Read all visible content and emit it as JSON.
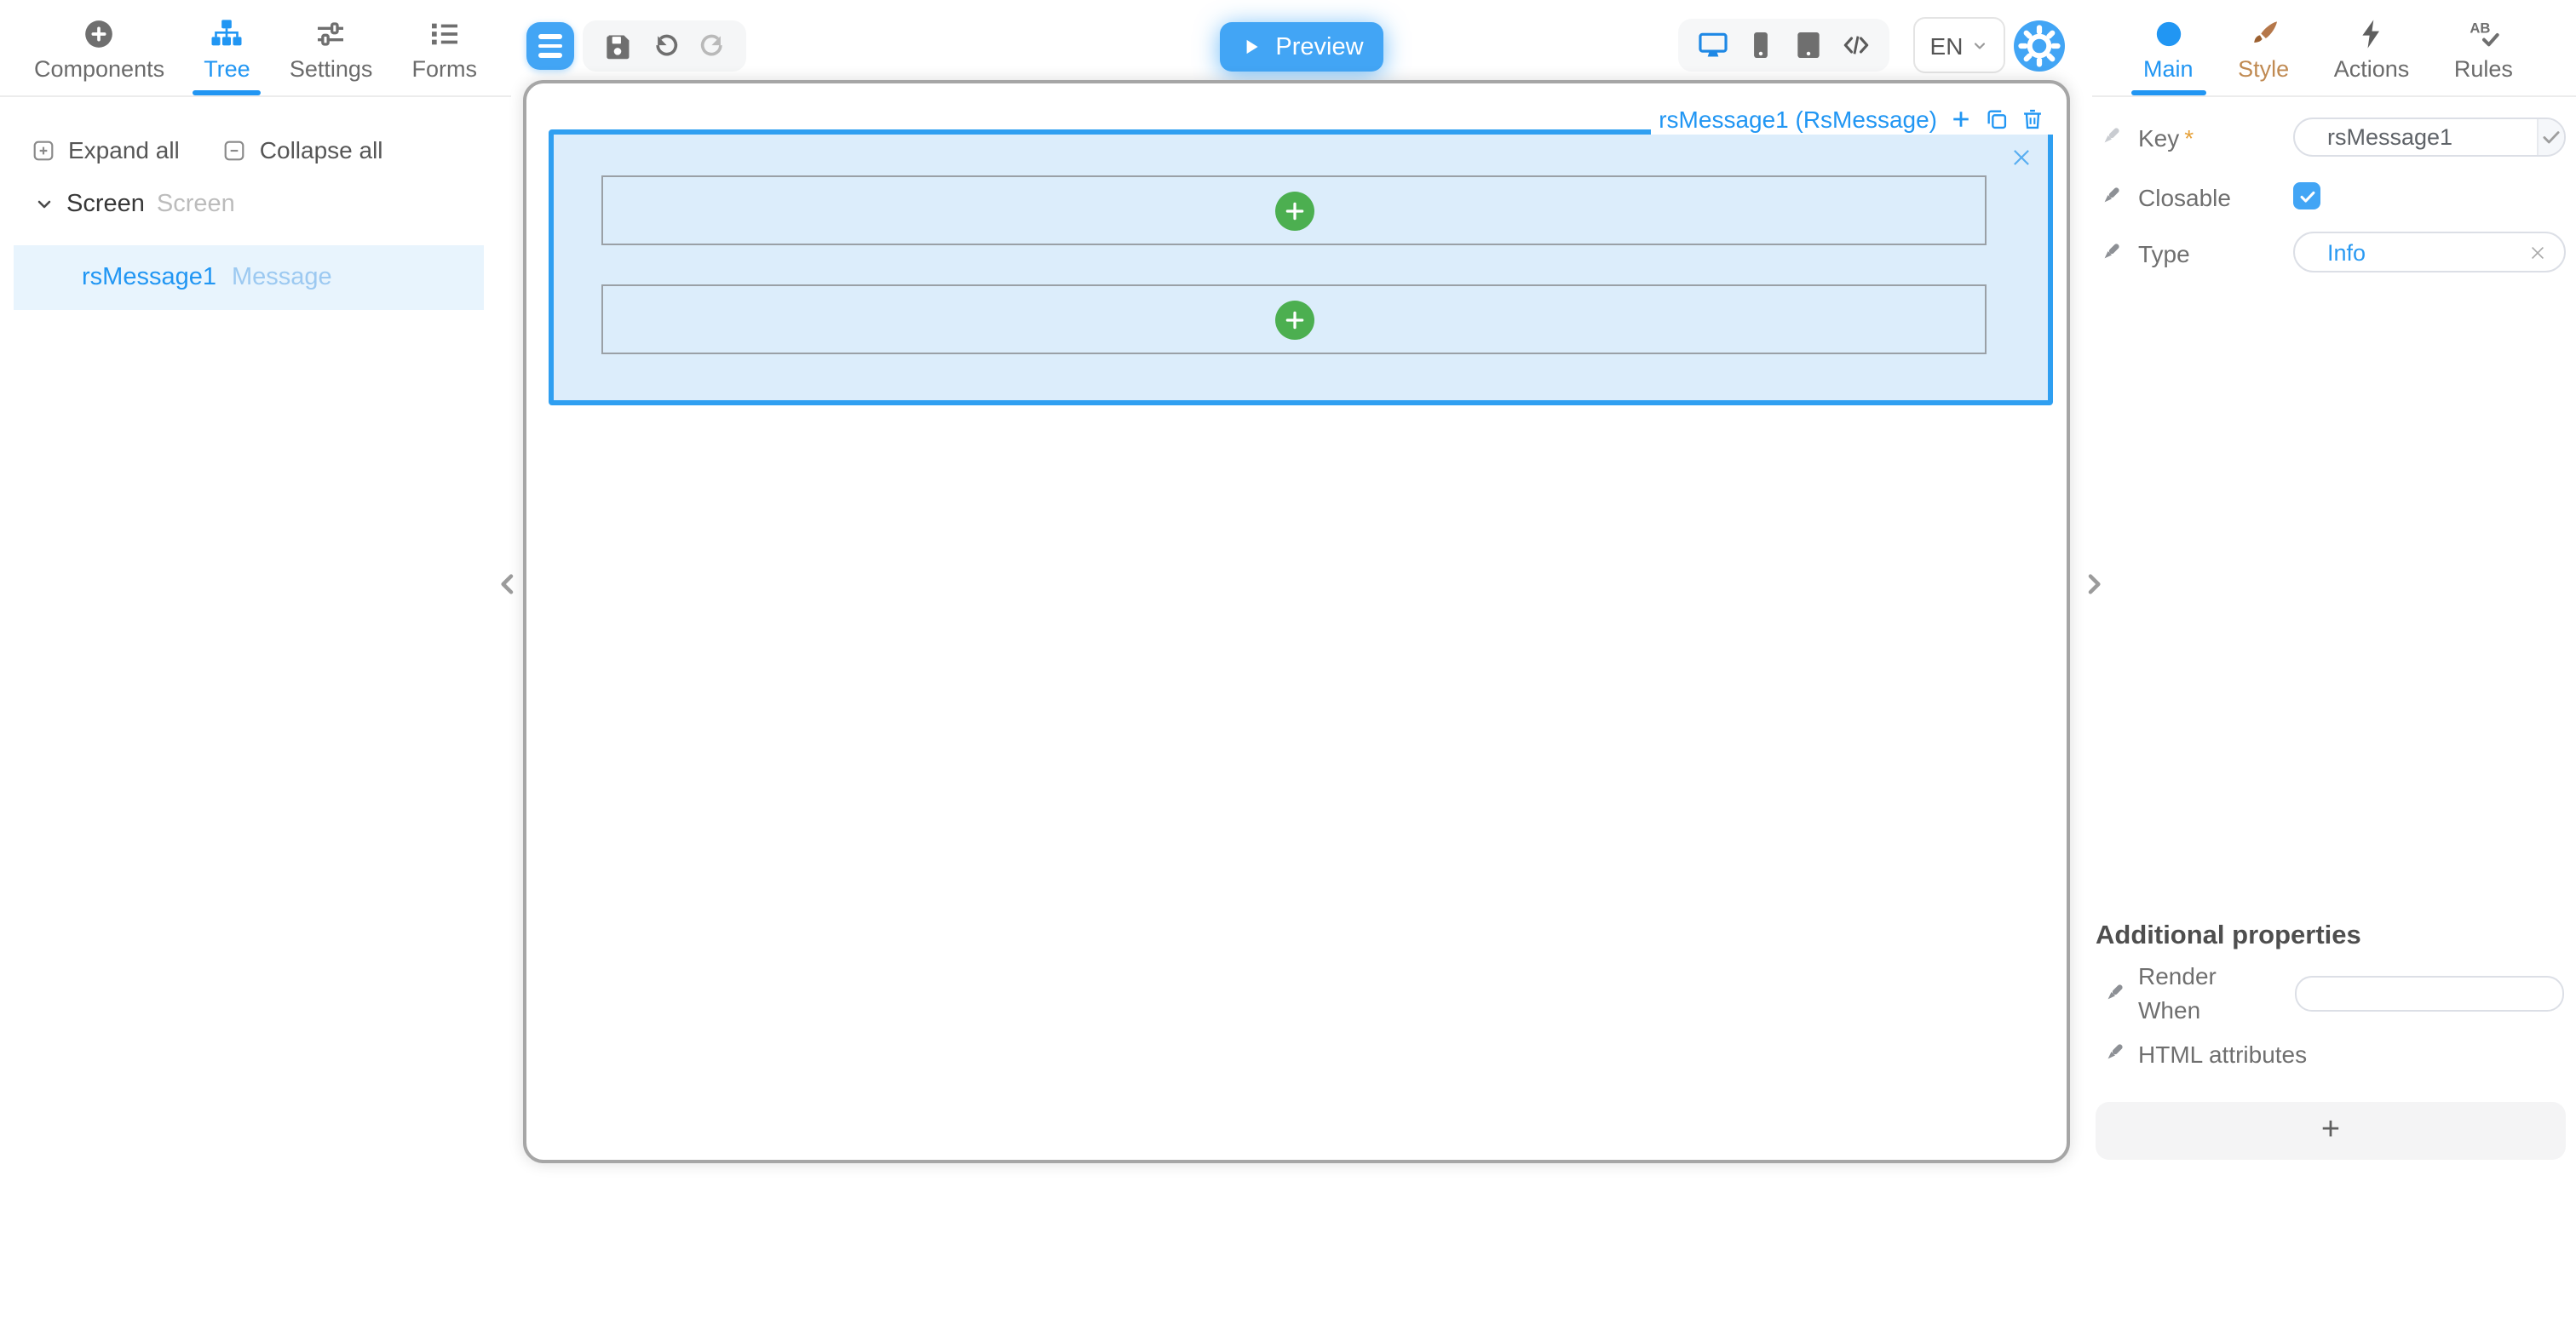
{
  "left_tabs": {
    "components": "Components",
    "tree": "Tree",
    "settings": "Settings",
    "forms": "Forms"
  },
  "tree_panel": {
    "expand_all": "Expand all",
    "collapse_all": "Collapse all",
    "root_name": "Screen",
    "root_type": "Screen",
    "node_name": "rsMessage1",
    "node_type": "Message"
  },
  "toolbar": {
    "preview": "Preview",
    "language": "EN"
  },
  "canvas": {
    "selection_label": "rsMessage1 (RsMessage)"
  },
  "right_tabs": {
    "main": "Main",
    "style": "Style",
    "actions": "Actions",
    "rules": "Rules"
  },
  "inspector": {
    "key_label": "Key",
    "key_required_mark": "*",
    "key_value": "rsMessage1",
    "closable_label": "Closable",
    "type_label": "Type",
    "type_value": "Info",
    "additional_heading": "Additional properties",
    "render_when_label": "Render When",
    "html_attributes_label": "HTML attributes",
    "add_property_label": "+"
  },
  "colors": {
    "accent_blue": "#2196f3",
    "button_blue": "#42a5f5",
    "message_bg": "#dcedfb",
    "message_border": "#2f9ff1",
    "success_green": "#4caf50",
    "required_orange": "#e6a23c"
  }
}
